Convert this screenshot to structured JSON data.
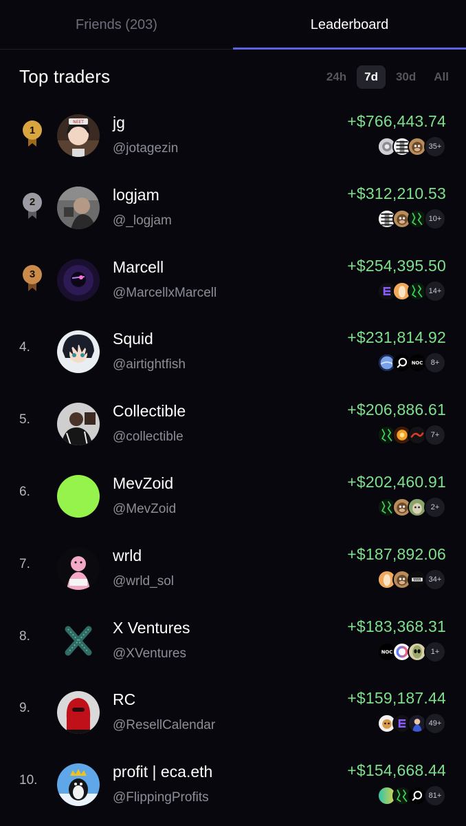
{
  "tabs": {
    "friends": "Friends (203)",
    "leaderboard": "Leaderboard"
  },
  "section_title": "Top traders",
  "periods": [
    "24h",
    "7d",
    "30d",
    "All"
  ],
  "active_period": "7d",
  "colors": {
    "profit": "#7ee08b",
    "accent": "#5a62e6",
    "gold": "#d9a53e",
    "silver": "#9a9aa3",
    "bronze": "#c98a4a"
  },
  "traders": [
    {
      "rank": "1",
      "name": "jg",
      "handle": "@jotagezin",
      "profit": "+$766,443.74",
      "more": "35+",
      "medal": "gold",
      "avatar": "anime-girl-avatar",
      "tokens": [
        "silver-coin-token",
        "bw-pattern-token",
        "monkey-token"
      ]
    },
    {
      "rank": "2",
      "name": "logjam",
      "handle": "@_logjam",
      "profit": "+$312,210.53",
      "more": "10+",
      "medal": "silver",
      "avatar": "man-photo-avatar",
      "tokens": [
        "bw-pattern-token",
        "monkey-token",
        "green-glitch-token"
      ]
    },
    {
      "rank": "3",
      "name": "Marcell",
      "handle": "@MarcellxMarcell",
      "profit": "+$254,395.50",
      "more": "14+",
      "medal": "bronze",
      "avatar": "glowing-eyes-avatar",
      "tokens": [
        "purple-logo-token",
        "orange-face-token",
        "green-glitch-token"
      ]
    },
    {
      "rank": "4.",
      "name": "Squid",
      "handle": "@airtightfish",
      "profit": "+$231,814.92",
      "more": "8+",
      "medal": "",
      "avatar": "anime-boy-avatar",
      "tokens": [
        "blue-planet-token",
        "ring-logo-token",
        "noc-token"
      ]
    },
    {
      "rank": "5.",
      "name": "Collectible",
      "handle": "@collectible",
      "profit": "+$206,886.61",
      "more": "7+",
      "medal": "",
      "avatar": "person-photo-avatar",
      "tokens": [
        "green-glitch-token",
        "fire-token",
        "red-logo-token"
      ]
    },
    {
      "rank": "6.",
      "name": "MevZoid",
      "handle": "@MevZoid",
      "profit": "+$202,460.91",
      "more": "2+",
      "medal": "",
      "avatar": "green-circle-avatar",
      "tokens": [
        "green-glitch-token",
        "monkey-token",
        "alien-cat-token"
      ]
    },
    {
      "rank": "7.",
      "name": "wrld",
      "handle": "@wrld_sol",
      "profit": "+$187,892.06",
      "more": "34+",
      "medal": "",
      "avatar": "pink-character-avatar",
      "tokens": [
        "orange-face-token",
        "monkey-token",
        "dark-logo-token"
      ]
    },
    {
      "rank": "8.",
      "name": "X Ventures",
      "handle": "@XVentures",
      "profit": "+$183,368.31",
      "more": "1+",
      "medal": "",
      "avatar": "x-logo-avatar",
      "tokens": [
        "noc-token",
        "gradient-ring-token",
        "alien-token"
      ]
    },
    {
      "rank": "9.",
      "name": "RC",
      "handle": "@ResellCalendar",
      "profit": "+$159,187.44",
      "more": "49+",
      "medal": "",
      "avatar": "red-mask-avatar",
      "tokens": [
        "dog-token",
        "purple-logo-token",
        "character-token"
      ]
    },
    {
      "rank": "10.",
      "name": "profit | eca.eth",
      "handle": "@FlippingProfits",
      "profit": "+$154,668.44",
      "more": "81+",
      "medal": "",
      "avatar": "crowned-penguin-avatar",
      "tokens": [
        "gradient-token",
        "green-glitch-token",
        "ring-logo-token"
      ]
    }
  ]
}
